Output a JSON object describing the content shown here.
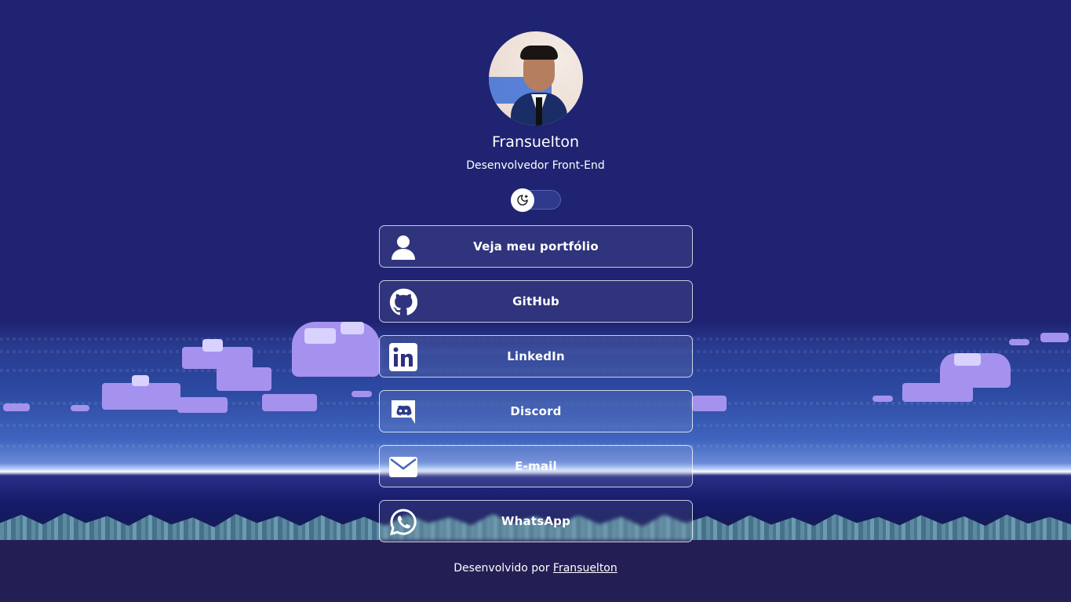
{
  "profile": {
    "name": "Fransuelton",
    "role": "Desenvolvedor Front-End"
  },
  "theme_toggle": {
    "icon": "moon-icon",
    "state": "dark"
  },
  "links": [
    {
      "label": "Veja meu portfólio",
      "icon": "user-icon"
    },
    {
      "label": "GitHub",
      "icon": "github-icon"
    },
    {
      "label": "LinkedIn",
      "icon": "linkedin-icon"
    },
    {
      "label": "Discord",
      "icon": "discord-icon"
    },
    {
      "label": "E-mail",
      "icon": "mail-icon"
    },
    {
      "label": "WhatsApp",
      "icon": "whatsapp-icon"
    }
  ],
  "footer": {
    "text": "Desenvolvido por",
    "link": "Fransuelton"
  },
  "colors": {
    "background": "#1f2371",
    "text": "#ffffff"
  }
}
